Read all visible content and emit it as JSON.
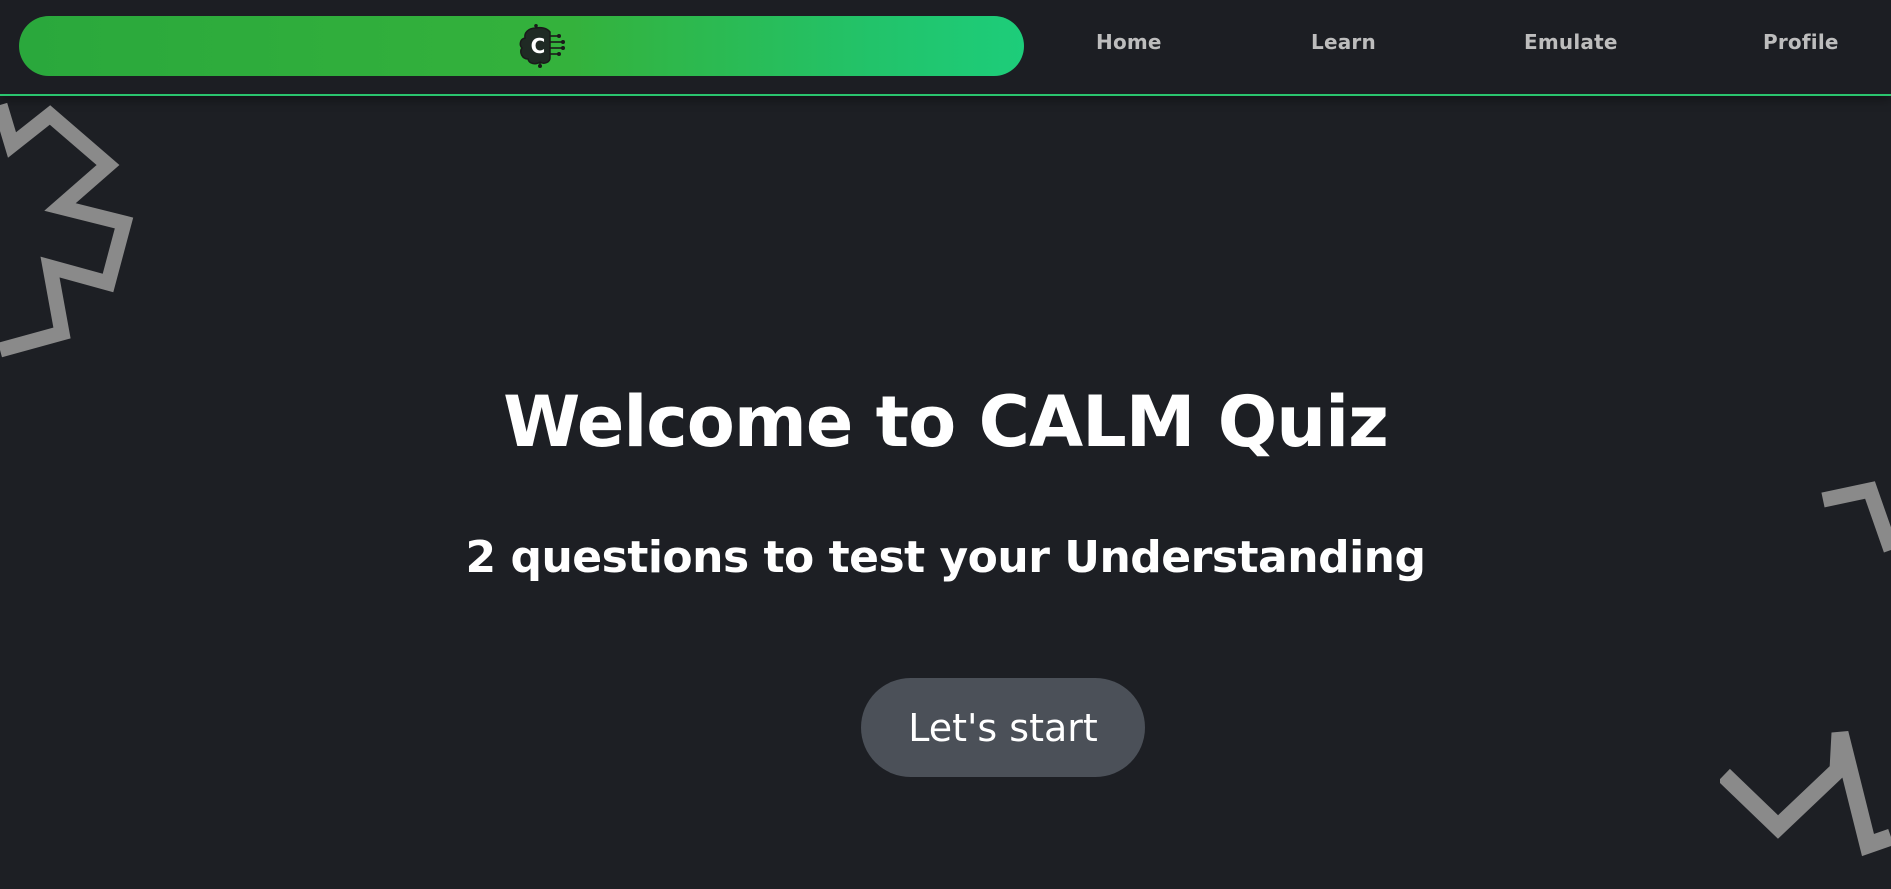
{
  "nav": {
    "logo": {
      "letter": "C",
      "icon": "brain-circuit-icon"
    },
    "links": [
      {
        "label": "Home"
      },
      {
        "label": "Learn"
      },
      {
        "label": "Emulate"
      },
      {
        "label": "Profile"
      }
    ]
  },
  "hero": {
    "title": "Welcome to CALM Quiz",
    "subtitle": "2 questions to test your Understanding",
    "start_button": "Let's start"
  },
  "colors": {
    "background": "#1d1f24",
    "accent_green": "#2aa83c",
    "accent_teal": "#1dcd7a",
    "button_bg": "#4b5058",
    "decoration_gray": "#8a8a8a"
  }
}
